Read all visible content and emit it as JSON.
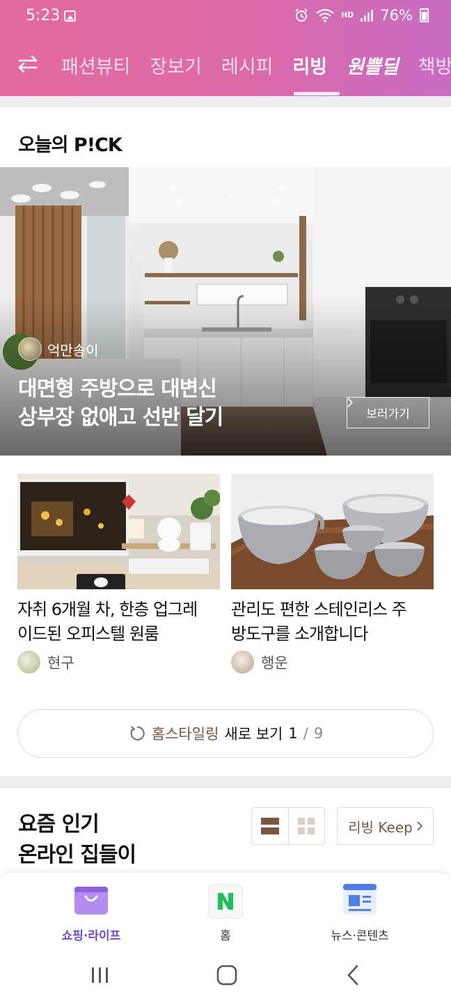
{
  "status_bar": {
    "time": "5:23",
    "battery": "76%",
    "hd_label": "HD",
    "icons": [
      "gallery-icon",
      "alarm-icon",
      "wifi-icon",
      "signal-icon",
      "battery-icon"
    ]
  },
  "top_nav": {
    "menu_icon": "swap-arrows-icon",
    "tabs": [
      {
        "label": "패션뷰티"
      },
      {
        "label": "장보기"
      },
      {
        "label": "레시피"
      },
      {
        "label": "리빙",
        "active": true
      },
      {
        "label": "원쁠딜"
      },
      {
        "label": "책방"
      }
    ],
    "accent_start": "#e46a9e",
    "accent_end": "#c86cc2"
  },
  "today_pick": {
    "title": "오늘의 P!CK",
    "hero": {
      "author": "억만송이",
      "headline_line1": "대면형 주방으로 대변신",
      "headline_line2": "상부장 없애고 선반 달기",
      "cta": "보러가기"
    },
    "cards": [
      {
        "title_line1": "자취 6개월 차, 한층 업그레",
        "title_line2": "이드된 오피스텔 원룸",
        "author": "현구"
      },
      {
        "title_line1": "관리도 편한 스테인리스 주",
        "title_line2": "방도구를 소개합니다",
        "author": "행운"
      }
    ],
    "refresh": {
      "category": "홈스타일링",
      "action": "새로 보기",
      "page": "1",
      "separator": "/",
      "total": "9"
    }
  },
  "popular": {
    "title_line1": "요즘 인기",
    "title_line2": "온라인 집들이",
    "keep_button": "리빙 Keep"
  },
  "bottom_nav": {
    "items": [
      {
        "label": "쇼핑·라이프",
        "active": true,
        "icon": "shopping-bag-icon"
      },
      {
        "label": "홈",
        "icon": "naver-n-icon"
      },
      {
        "label": "뉴스·콘텐츠",
        "icon": "news-icon"
      }
    ],
    "active_color": "#6c4bd6"
  },
  "system_nav": {
    "icons": [
      "recents-icon",
      "home-icon",
      "back-icon"
    ]
  }
}
